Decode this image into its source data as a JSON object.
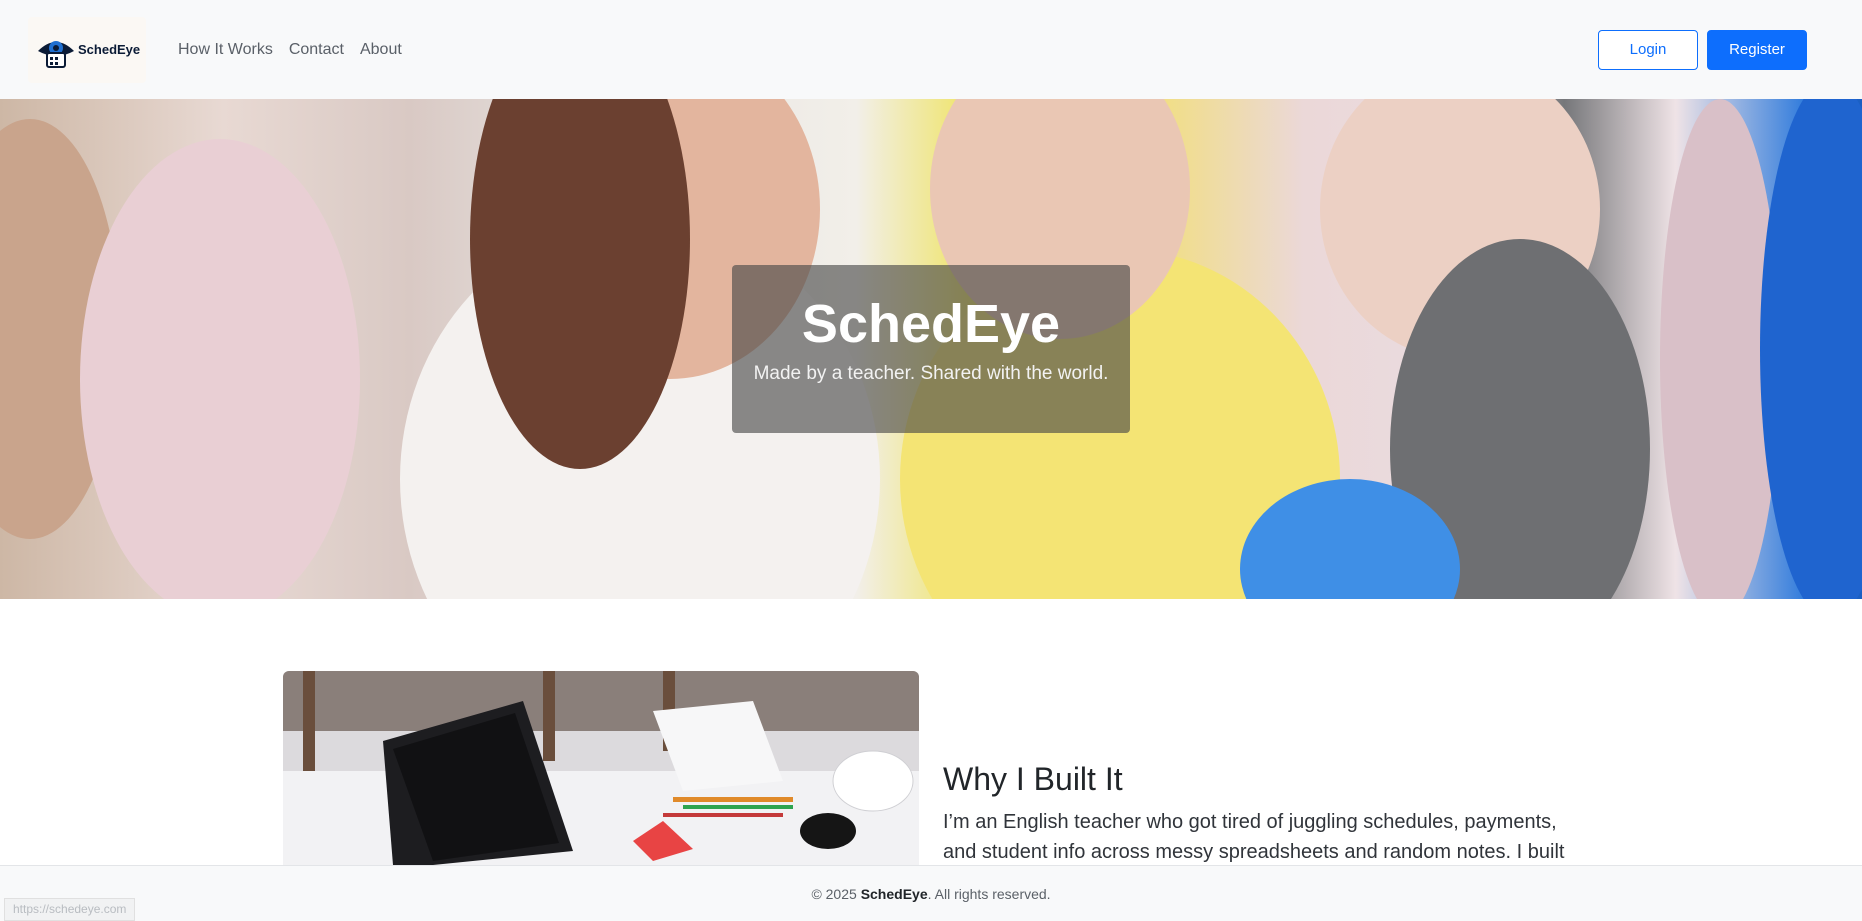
{
  "navbar": {
    "brand_name": "SchedEye",
    "links": [
      "How It Works",
      "Contact",
      "About"
    ],
    "login_label": "Login",
    "register_label": "Register"
  },
  "hero": {
    "title": "SchedEye",
    "subtitle": "Made by a teacher. Shared with the world."
  },
  "why": {
    "title": "Why I Built It",
    "text": "I’m an English teacher who got tired of juggling schedules, payments, and student info across messy spreadsheets and random notes. I built"
  },
  "footer": {
    "copyright_prefix": "© 2025 ",
    "brand": "SchedEye",
    "suffix": ". All rights reserved."
  },
  "status_bar": {
    "url": "https://schedeye.com"
  },
  "colors": {
    "primary": "#0d6efd",
    "navbar_bg": "#f8f9fa",
    "brand_dark": "#0b1b36"
  }
}
